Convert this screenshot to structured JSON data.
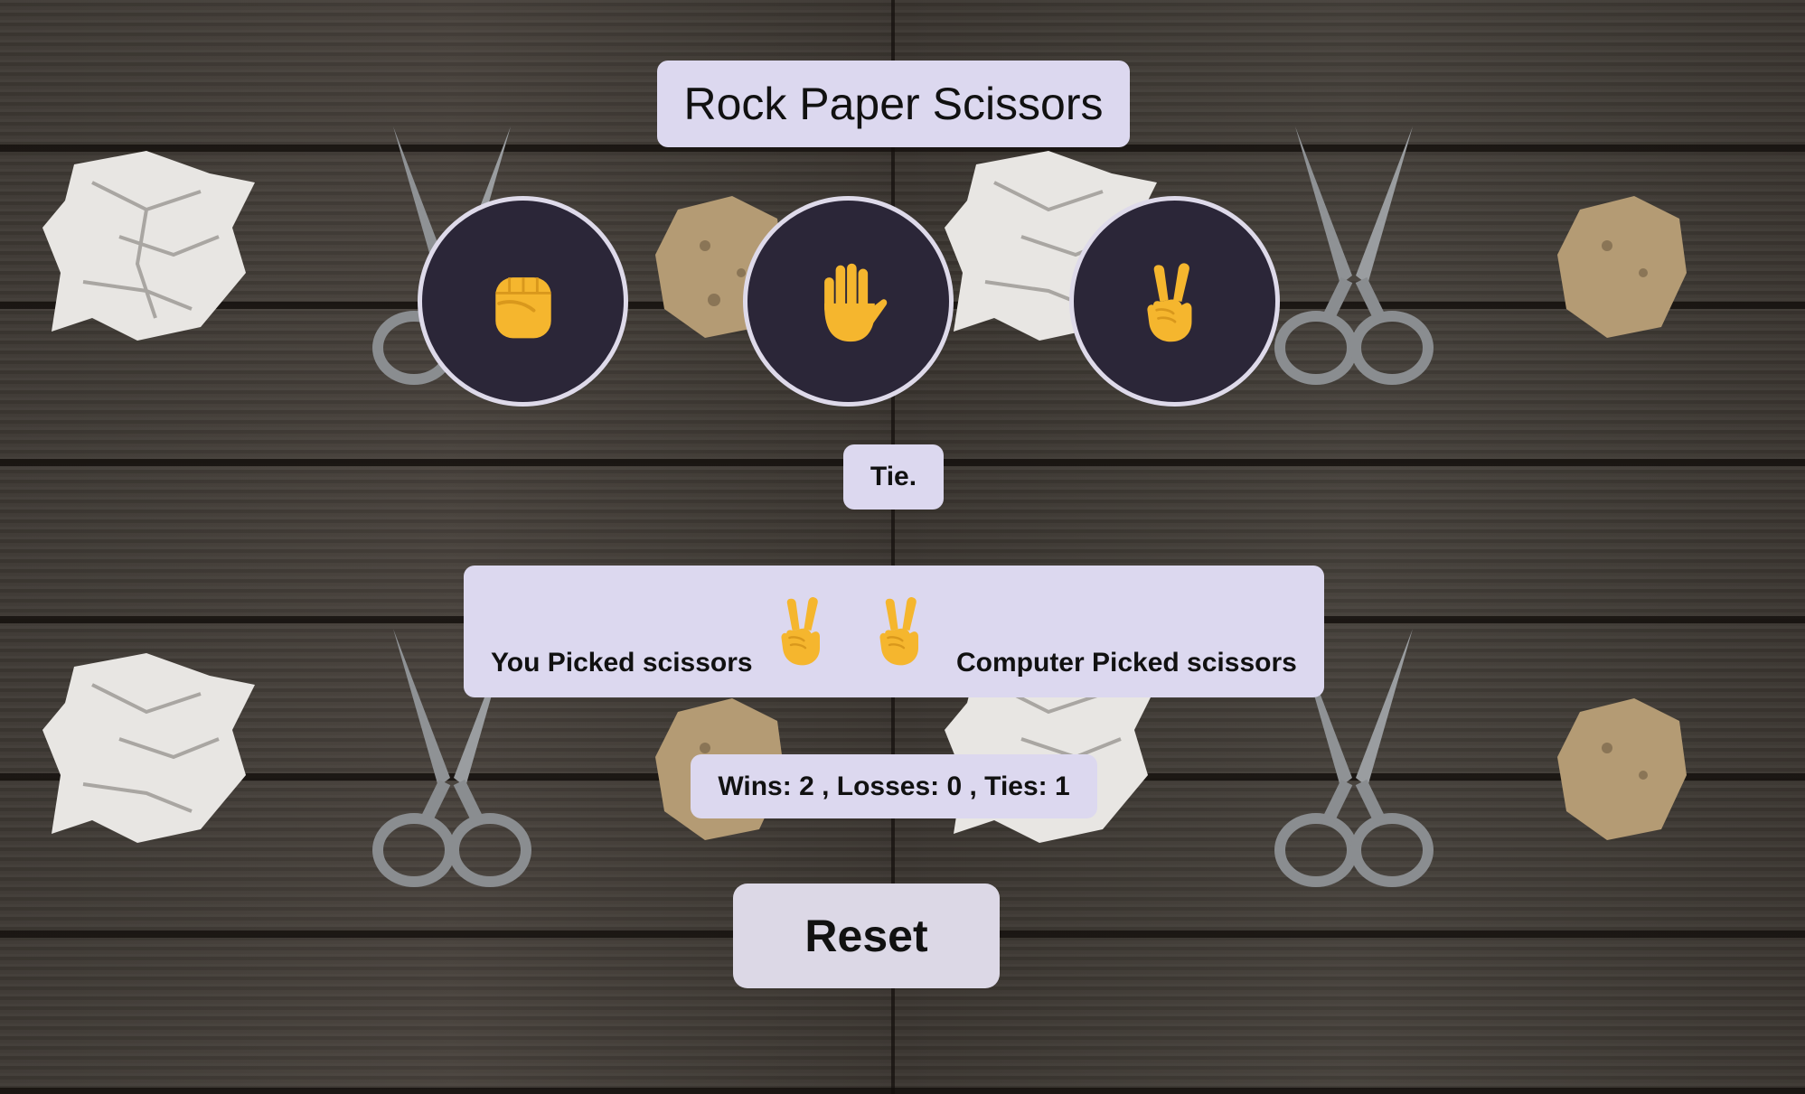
{
  "title": "Rock Paper Scissors",
  "choices": [
    {
      "name": "rock",
      "icon": "raised-fist-icon"
    },
    {
      "name": "paper",
      "icon": "raised-hand-icon"
    },
    {
      "name": "scissors",
      "icon": "victory-hand-icon"
    }
  ],
  "result": "Tie.",
  "picks": {
    "you_label": "You Picked scissors",
    "you_icon": "victory-hand-icon",
    "computer_label": "Computer Picked scissors",
    "computer_icon": "victory-hand-icon"
  },
  "score": {
    "text": "Wins: 2 , Losses: 0 , Ties: 1"
  },
  "reset_label": "Reset",
  "colors": {
    "panel": "#dcd8ef",
    "button_bg": "#2b2638",
    "button_border": "#dedaea",
    "emoji": "#f5b62e",
    "table_wood": "#3d3833"
  }
}
